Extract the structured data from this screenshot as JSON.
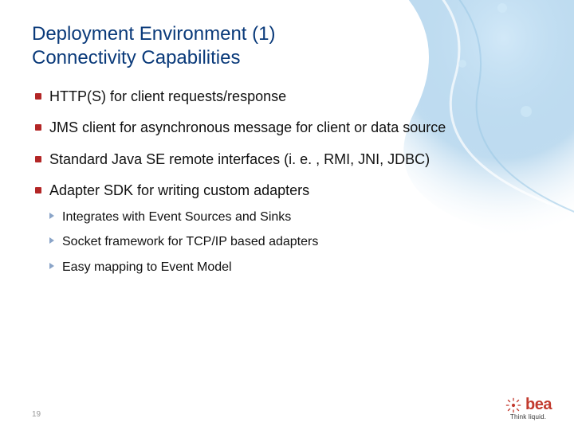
{
  "title_line1": "Deployment Environment (1)",
  "title_line2": "Connectivity Capabilities",
  "bullets": [
    {
      "text": "HTTP(S) for client requests/response"
    },
    {
      "text": "JMS client for asynchronous message for client or data source"
    },
    {
      "text": "Standard Java SE remote interfaces (i. e. , RMI, JNI, JDBC)"
    },
    {
      "text": "Adapter SDK for writing custom adapters",
      "sub": [
        "Integrates with Event Sources and Sinks",
        "Socket framework for TCP/IP based adapters",
        "Easy mapping to Event Model"
      ]
    }
  ],
  "page_number": "19",
  "logo": {
    "text": "bea",
    "tagline": "Think liquid."
  },
  "colors": {
    "title": "#0a3a7a",
    "bullet": "#b32626",
    "sub_arrow": "#8aa4c8",
    "logo": "#c23a2e"
  }
}
